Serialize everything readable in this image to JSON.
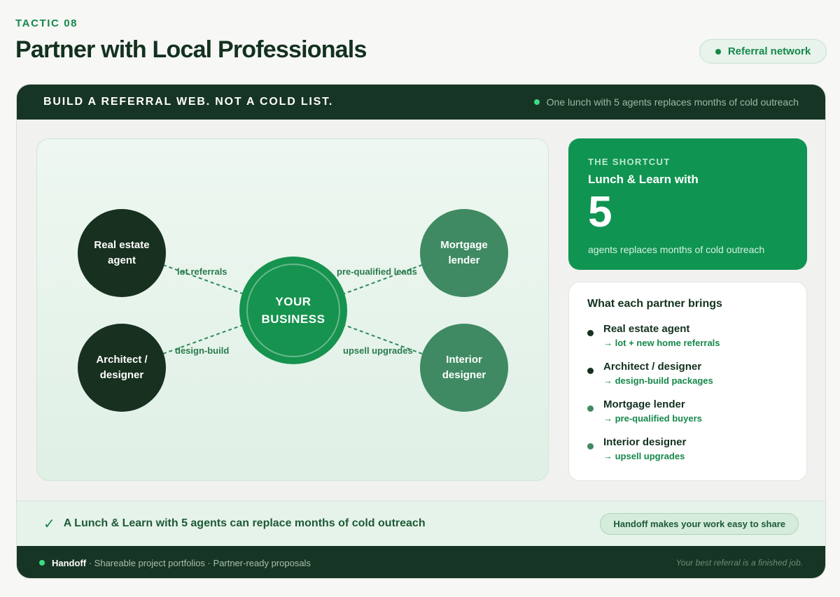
{
  "header": {
    "eyebrow": "TACTIC 08",
    "title": "Partner with Local Professionals",
    "pill_label": "Referral network"
  },
  "card": {
    "header_title": "BUILD A REFERRAL WEB. NOT A COLD LIST.",
    "header_note": "One lunch with 5 agents replaces months of cold outreach"
  },
  "diagram": {
    "center": {
      "line1": "YOUR",
      "line2": "BUSINESS"
    },
    "nodes": [
      {
        "line1": "Real estate",
        "line2": "agent",
        "edge_label": "lot referrals"
      },
      {
        "line1": "Architect /",
        "line2": "designer",
        "edge_label": "design-build"
      },
      {
        "line1": "Mortgage",
        "line2": "lender",
        "edge_label": "pre-qualified leads"
      },
      {
        "line1": "Interior",
        "line2": "designer",
        "edge_label": "upsell upgrades"
      }
    ]
  },
  "shortcut": {
    "eyebrow": "THE SHORTCUT",
    "title": "Lunch & Learn with",
    "number": "5",
    "desc": "agents replaces months of cold outreach"
  },
  "partners": {
    "title": "What each partner brings",
    "items": [
      {
        "name": "Real estate agent",
        "benefit": "→ lot + new home referrals",
        "color": "#18301f"
      },
      {
        "name": "Architect / designer",
        "benefit": "→ design-build packages",
        "color": "#18301f"
      },
      {
        "name": "Mortgage lender",
        "benefit": "→ pre-qualified buyers",
        "color": "#3f8a63"
      },
      {
        "name": "Interior designer",
        "benefit": "→ upsell upgrades",
        "color": "#3f8a63"
      }
    ]
  },
  "banner": {
    "text": "A Lunch & Learn with 5 agents can replace months of cold outreach",
    "pill": "Handoff makes your work easy to share"
  },
  "footer": {
    "brand": "Handoff",
    "items": "· Shareable project portfolios · Partner-ready proposals",
    "tagline": "Your best referral is a finished job."
  },
  "colors": {
    "accent": "#15884a",
    "dark": "#173524",
    "bright_dot": "#3ddc84"
  }
}
